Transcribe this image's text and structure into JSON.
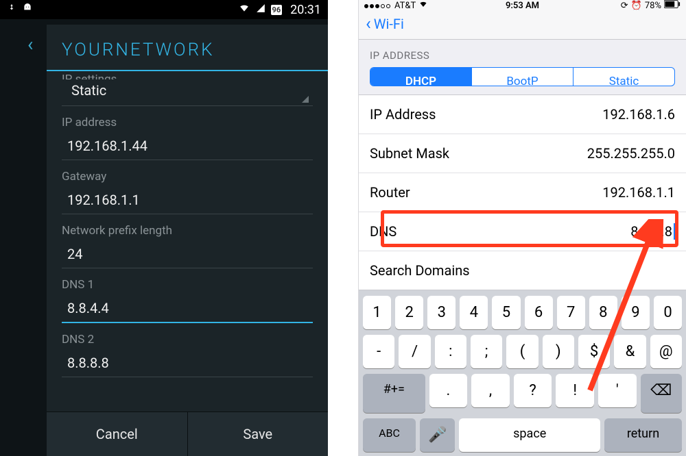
{
  "android": {
    "status": {
      "battery": "96",
      "time": "20:31"
    },
    "title": "YOURNETWORK",
    "ip_settings_hint": "IP settings",
    "ip_settings_value": "Static",
    "fields": {
      "ip_label": "IP address",
      "ip_value": "192.168.1.44",
      "gw_label": "Gateway",
      "gw_value": "192.168.1.1",
      "prefix_label": "Network prefix length",
      "prefix_value": "24",
      "dns1_label": "DNS 1",
      "dns1_value": "8.8.4.4",
      "dns2_label": "DNS 2",
      "dns2_value": "8.8.8.8"
    },
    "actions": {
      "cancel": "Cancel",
      "save": "Save"
    }
  },
  "ios": {
    "status": {
      "carrier": "AT&T",
      "time": "9:53 AM",
      "battery": "78%"
    },
    "back_label": "Wi-Fi",
    "section": "IP Address",
    "segments": {
      "dhcp": "DHCP",
      "bootp": "BootP",
      "static": "Static"
    },
    "rows": {
      "ip_k": "IP Address",
      "ip_v": "192.168.1.6",
      "mask_k": "Subnet Mask",
      "mask_v": "255.255.255.0",
      "router_k": "Router",
      "router_v": "192.168.1.1",
      "dns_k": "DNS",
      "dns_v": "8.8.8.8",
      "search_k": "Search Domains",
      "search_v": ""
    },
    "keyboard": {
      "r1": [
        "1",
        "2",
        "3",
        "4",
        "5",
        "6",
        "7",
        "8",
        "9",
        "0"
      ],
      "r2": [
        "-",
        "/",
        ":",
        ";",
        "(",
        ")",
        "$",
        "&",
        "@"
      ],
      "r3_shift": "#+=",
      "r3": [
        ".",
        ",",
        "?",
        "!",
        "'"
      ],
      "abc": "ABC",
      "space": "space",
      "return": "return"
    }
  }
}
